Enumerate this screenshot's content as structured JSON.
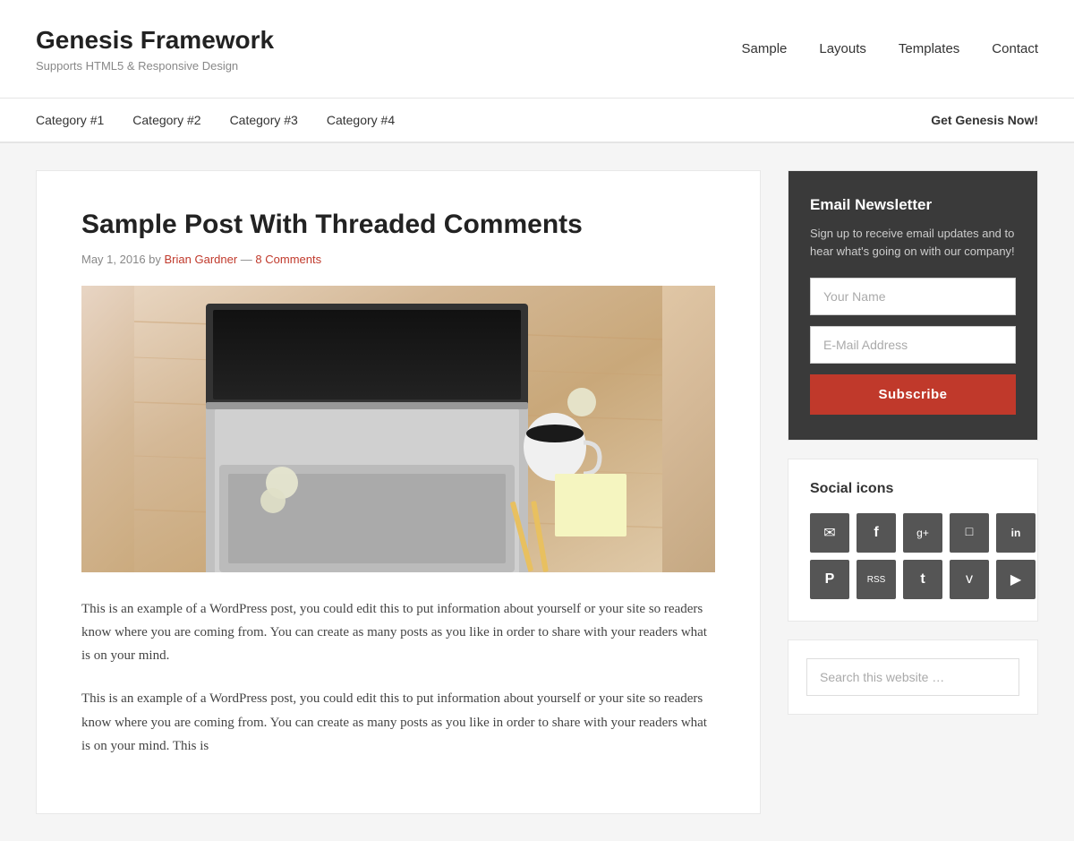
{
  "site": {
    "title": "Genesis Framework",
    "subtitle": "Supports HTML5 & Responsive Design"
  },
  "main_nav": {
    "items": [
      {
        "label": "Sample",
        "href": "#"
      },
      {
        "label": "Layouts",
        "href": "#"
      },
      {
        "label": "Templates",
        "href": "#"
      },
      {
        "label": "Contact",
        "href": "#"
      }
    ]
  },
  "secondary_nav": {
    "left_items": [
      {
        "label": "Category #1",
        "href": "#"
      },
      {
        "label": "Category #2",
        "href": "#"
      },
      {
        "label": "Category #3",
        "href": "#"
      },
      {
        "label": "Category #4",
        "href": "#"
      }
    ],
    "right_item": {
      "label": "Get Genesis Now!",
      "href": "#"
    }
  },
  "post": {
    "title": "Sample Post With Threaded Comments",
    "date": "May 1, 2016",
    "author": "Brian Gardner",
    "author_link": "#",
    "comments": "8 Comments",
    "comments_link": "#",
    "body_1": "This is an example of a WordPress post, you could edit this to put information about yourself or your site so readers know where you are coming from. You can create as many posts as you like in order to share with your readers what is on your mind.",
    "body_2": "This is an example of a WordPress post, you could edit this to put information about yourself or your site so readers know where you are coming from. You can create as many posts as you like in order to share with your readers what is on your mind. This is"
  },
  "sidebar": {
    "newsletter": {
      "title": "Email Newsletter",
      "description": "Sign up to receive email updates and to hear what's going on with our company!",
      "name_placeholder": "Your Name",
      "email_placeholder": "E-Mail Address",
      "button_label": "Subscribe"
    },
    "social": {
      "title": "Social icons",
      "icons": [
        {
          "name": "email-icon",
          "symbol": "✉"
        },
        {
          "name": "facebook-icon",
          "symbol": "f"
        },
        {
          "name": "google-plus-icon",
          "symbol": "g+"
        },
        {
          "name": "instagram-icon",
          "symbol": "📷"
        },
        {
          "name": "linkedin-icon",
          "symbol": "in"
        },
        {
          "name": "pinterest-icon",
          "symbol": "P"
        },
        {
          "name": "rss-icon",
          "symbol": "RSS"
        },
        {
          "name": "twitter-icon",
          "symbol": "t"
        },
        {
          "name": "vimeo-icon",
          "symbol": "v"
        },
        {
          "name": "youtube-icon",
          "symbol": "▶"
        }
      ]
    },
    "search": {
      "placeholder": "Search this website …"
    }
  }
}
